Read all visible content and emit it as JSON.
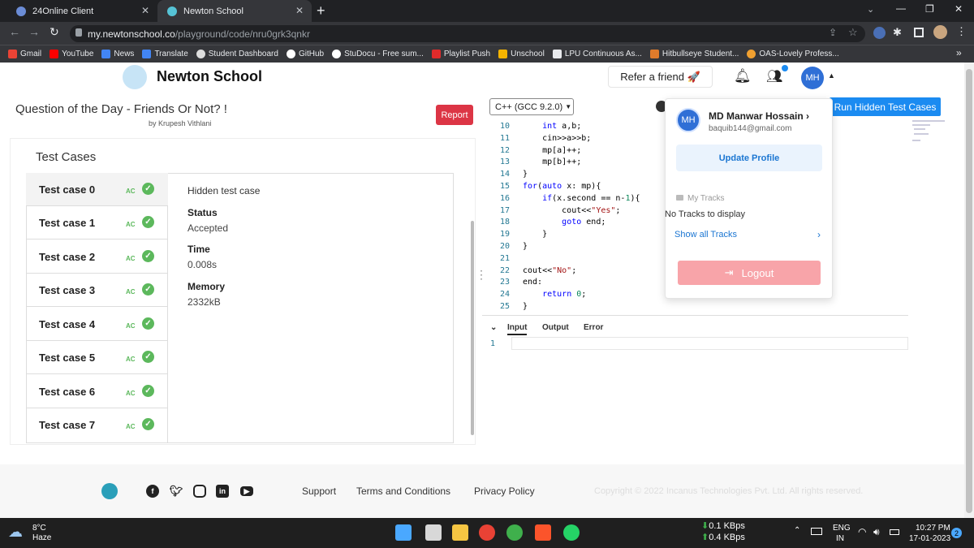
{
  "browser": {
    "tabs": [
      {
        "title": "24Online Client"
      },
      {
        "title": "Newton School"
      }
    ],
    "url_host": "my.newtonschool.co",
    "url_path": "/playground/code/nru0grk3qnkr",
    "bookmarks": [
      "Gmail",
      "YouTube",
      "News",
      "Translate",
      "Student Dashboard",
      "GitHub",
      "StuDocu - Free sum...",
      "Playlist Push",
      "Unschool",
      "LPU Continuous As...",
      "Hitbullseye Student...",
      "OAS-Lovely Profess..."
    ],
    "more_bookmarks": "»"
  },
  "site": {
    "logo_text": "Newton School",
    "refer_label": "Refer a friend",
    "refer_emoji": "🚀",
    "avatar_initials": "MH"
  },
  "question": {
    "title": "Question of the Day - Friends Or Not? !",
    "author": "by Krupesh Vithlani",
    "report_label": "Report"
  },
  "testcases": {
    "heading": "Test Cases",
    "items": [
      {
        "label": "Test case 0",
        "status": "AC"
      },
      {
        "label": "Test case 1",
        "status": "AC"
      },
      {
        "label": "Test case 2",
        "status": "AC"
      },
      {
        "label": "Test case 3",
        "status": "AC"
      },
      {
        "label": "Test case 4",
        "status": "AC"
      },
      {
        "label": "Test case 5",
        "status": "AC"
      },
      {
        "label": "Test case 6",
        "status": "AC"
      },
      {
        "label": "Test case 7",
        "status": "AC"
      }
    ],
    "detail": {
      "heading": "Hidden test case",
      "status_label": "Status",
      "status_value": "Accepted",
      "time_label": "Time",
      "time_value": "0.008s",
      "memory_label": "Memory",
      "memory_value": "2332kB"
    }
  },
  "editor": {
    "language": "C++ (GCC 9.2.0)",
    "run_hidden_label": "Run Hidden Test Cases",
    "lines": [
      {
        "n": "10",
        "code": "    int a,b;"
      },
      {
        "n": "11",
        "code": "    cin>>a>>b;"
      },
      {
        "n": "12",
        "code": "    mp[a]++;"
      },
      {
        "n": "13",
        "code": "    mp[b]++;"
      },
      {
        "n": "14",
        "code": "}"
      },
      {
        "n": "15",
        "code": "for(auto x: mp){"
      },
      {
        "n": "16",
        "code": "    if(x.second == n-1){"
      },
      {
        "n": "17",
        "code": "        cout<<\"Yes\";"
      },
      {
        "n": "18",
        "code": "        goto end;"
      },
      {
        "n": "19",
        "code": "    }"
      },
      {
        "n": "20",
        "code": "}"
      },
      {
        "n": "21",
        "code": ""
      },
      {
        "n": "22",
        "code": "cout<<\"No\";"
      },
      {
        "n": "23",
        "code": "end:"
      },
      {
        "n": "24",
        "code": "    return 0;"
      },
      {
        "n": "25",
        "code": "}"
      }
    ],
    "io_tabs": [
      "Input",
      "Output",
      "Error"
    ],
    "io_line_number": "1"
  },
  "dropdown": {
    "initials": "MH",
    "name": "MD Manwar Hossain",
    "email": "baquib144@gmail.com",
    "update_profile": "Update Profile",
    "my_tracks": "My Tracks",
    "no_tracks": "No Tracks to display",
    "show_all_tracks": "Show all Tracks",
    "logout": "Logout"
  },
  "footer": {
    "links": [
      "Support",
      "Terms and Conditions",
      "Privacy Policy"
    ],
    "copyright": "Copyright © 2022 Incanus Technologies Pvt. Ltd. All rights reserved."
  },
  "taskbar": {
    "temperature": "8°C",
    "weather": "Haze",
    "net_down": "0.1 KBps",
    "net_up": "0.4 KBps",
    "lang": "ENG",
    "region": "IN",
    "time": "10:27 PM",
    "date": "17-01-2023",
    "notifications": "2"
  }
}
